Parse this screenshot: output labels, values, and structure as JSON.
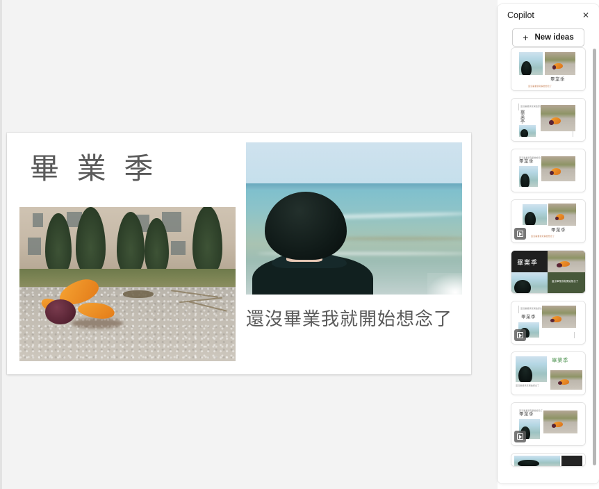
{
  "app": {
    "canvas_background": "#f3f3f3"
  },
  "slide": {
    "title": "畢 業 季",
    "caption": "還沒畢業我就開始想念了",
    "title_color": "#5a5a5a",
    "caption_color": "#5a5a5a",
    "background": "#ffffff",
    "images": [
      {
        "name": "flower-on-gravel-photo",
        "alt": "Orange flower lying on gravel in front of a campus building"
      },
      {
        "name": "person-facing-sea-photo",
        "alt": "Person with bob haircut seen from behind facing the sea"
      }
    ]
  },
  "copilot": {
    "title": "Copilot",
    "close_label": "✕",
    "new_ideas": {
      "plus": "+",
      "label": "New ideas"
    },
    "ideas": [
      {
        "name": "design-idea-1",
        "title": "畢業季",
        "caption": "還沒畢業我就開始想念了",
        "has_video": false,
        "theme": "light"
      },
      {
        "name": "design-idea-2",
        "title": "畢業季",
        "caption": "還沒畢業我就開始想念了",
        "has_video": false,
        "theme": "light"
      },
      {
        "name": "design-idea-3",
        "title": "畢業季",
        "caption": "還沒畢業我就開始想念了",
        "has_video": false,
        "theme": "light"
      },
      {
        "name": "design-idea-4",
        "title": "畢業季",
        "caption": "還沒畢業我就開始想念了",
        "has_video": true,
        "theme": "light"
      },
      {
        "name": "design-idea-5",
        "title": "畢業季",
        "caption": "還沒畢業我就開始想念了",
        "has_video": false,
        "theme": "dark"
      },
      {
        "name": "design-idea-6",
        "title": "畢業季",
        "caption": "還沒畢業我就開始想念了",
        "has_video": true,
        "theme": "light"
      },
      {
        "name": "design-idea-7",
        "title": "畢業季",
        "caption": "還沒畢業我就開始想念了",
        "has_video": false,
        "theme": "light"
      },
      {
        "name": "design-idea-8",
        "title": "畢業季",
        "caption": "還沒畢業我就開始想念了",
        "has_video": true,
        "theme": "light"
      },
      {
        "name": "design-idea-9",
        "title": "",
        "caption": "",
        "has_video": false,
        "theme": "light"
      }
    ]
  }
}
